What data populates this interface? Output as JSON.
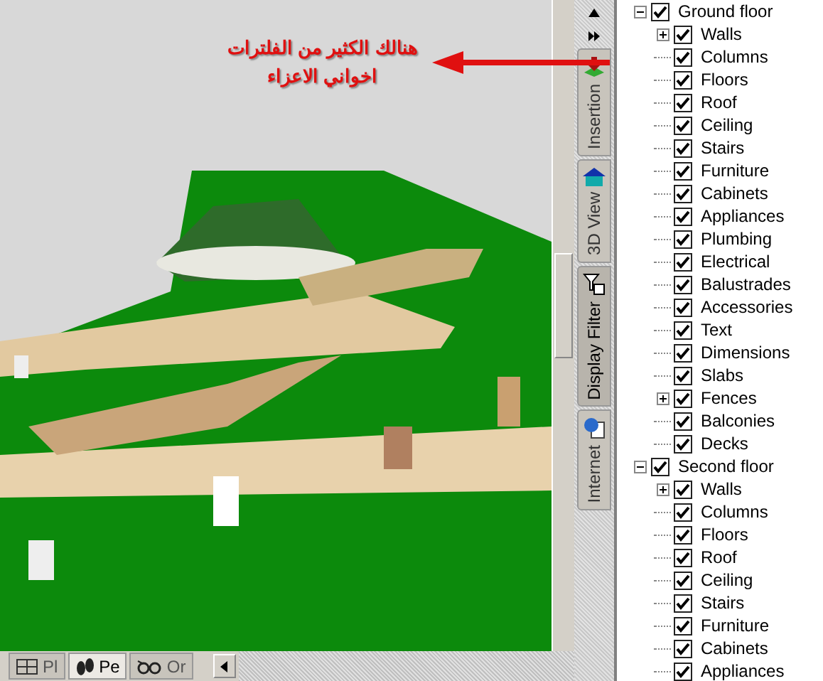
{
  "annotation": {
    "lines": [
      "هنالك الكثير من الفلترات",
      "اخواني الاعزاء"
    ]
  },
  "side_tabs": [
    {
      "label": "Insertion",
      "selected": false,
      "kind": "insert"
    },
    {
      "label": "3D View",
      "selected": false,
      "kind": "house"
    },
    {
      "label": "Display Filter",
      "selected": true,
      "kind": "filter"
    },
    {
      "label": "Internet",
      "selected": false,
      "kind": "globe"
    }
  ],
  "tree": [
    {
      "label": "Ground floor",
      "checked": true,
      "expanded": true,
      "children": [
        {
          "label": "Walls",
          "checked": true,
          "expanded": false
        },
        {
          "label": "Columns",
          "checked": true
        },
        {
          "label": "Floors",
          "checked": true
        },
        {
          "label": "Roof",
          "checked": true
        },
        {
          "label": "Ceiling",
          "checked": true
        },
        {
          "label": "Stairs",
          "checked": true
        },
        {
          "label": "Furniture",
          "checked": true
        },
        {
          "label": "Cabinets",
          "checked": true
        },
        {
          "label": "Appliances",
          "checked": true
        },
        {
          "label": "Plumbing",
          "checked": true
        },
        {
          "label": "Electrical",
          "checked": true
        },
        {
          "label": "Balustrades",
          "checked": true
        },
        {
          "label": "Accessories",
          "checked": true
        },
        {
          "label": "Text",
          "checked": true
        },
        {
          "label": "Dimensions",
          "checked": true
        },
        {
          "label": "Slabs",
          "checked": true
        },
        {
          "label": "Fences",
          "checked": true,
          "expanded": false
        },
        {
          "label": "Balconies",
          "checked": true
        },
        {
          "label": "Decks",
          "checked": true
        }
      ]
    },
    {
      "label": "Second floor",
      "checked": true,
      "expanded": true,
      "children": [
        {
          "label": "Walls",
          "checked": true,
          "expanded": false
        },
        {
          "label": "Columns",
          "checked": true
        },
        {
          "label": "Floors",
          "checked": true
        },
        {
          "label": "Roof",
          "checked": true
        },
        {
          "label": "Ceiling",
          "checked": true
        },
        {
          "label": "Stairs",
          "checked": true
        },
        {
          "label": "Furniture",
          "checked": true
        },
        {
          "label": "Cabinets",
          "checked": true
        },
        {
          "label": "Appliances",
          "checked": true
        }
      ]
    }
  ],
  "bottom_tabs": [
    {
      "label": "Pl",
      "selected": false,
      "kind": "plan"
    },
    {
      "label": "Pe",
      "selected": true,
      "kind": "person"
    },
    {
      "label": "Or",
      "selected": false,
      "kind": "glasses"
    }
  ]
}
